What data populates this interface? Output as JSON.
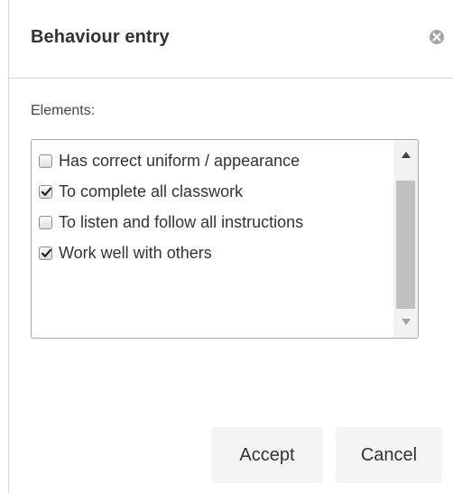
{
  "dialog": {
    "title": "Behaviour entry",
    "close_icon": "close-circle-icon"
  },
  "elements": {
    "label": "Elements:",
    "options": [
      {
        "label": "Has correct uniform / appearance",
        "checked": false
      },
      {
        "label": "To complete all classwork",
        "checked": true
      },
      {
        "label": "To listen and follow all instructions",
        "checked": false
      },
      {
        "label": "Work well with others",
        "checked": true
      }
    ],
    "scroll_up_icon": "triangle-up-icon",
    "scroll_down_icon": "triangle-down-icon"
  },
  "footer": {
    "accept_label": "Accept",
    "cancel_label": "Cancel"
  },
  "colors": {
    "thumb": "#c1c1c1",
    "track": "#f2f2f2",
    "button_bg": "#f4f4f4"
  }
}
